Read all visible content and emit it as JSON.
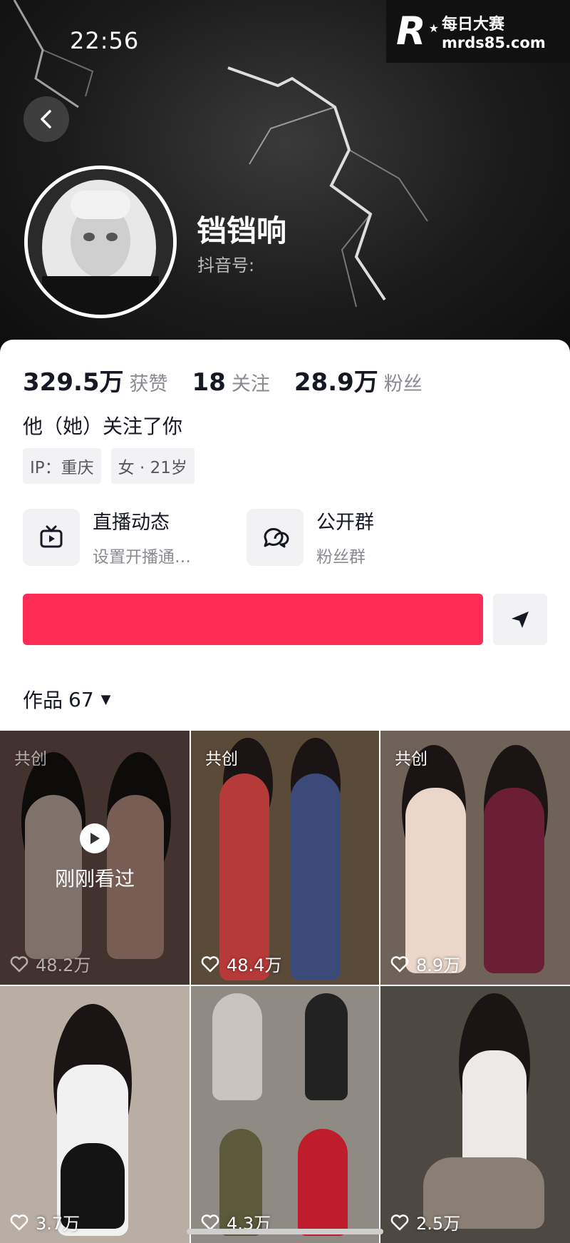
{
  "status_bar": {
    "time": "22:56"
  },
  "watermark": {
    "logo_letter": "R",
    "name": "每日大赛",
    "url": "mrds85.com"
  },
  "profile": {
    "nickname": "铛铛响",
    "douyin_id_label": "抖音号:",
    "stats": [
      {
        "value": "329.5万",
        "label": "获赞"
      },
      {
        "value": "18",
        "label": "关注"
      },
      {
        "value": "28.9万",
        "label": "粉丝"
      }
    ],
    "follow_relation": "他（她）关注了你",
    "tags": [
      "IP：重庆",
      "女 · 21岁"
    ]
  },
  "entries": [
    {
      "title": "直播动态",
      "subtitle": "设置开播通…",
      "icon": "tv-icon"
    },
    {
      "title": "公开群",
      "subtitle": "粉丝群",
      "icon": "chat-bubbles-icon"
    }
  ],
  "actions": {
    "follow_label": "",
    "send_icon": "send-icon"
  },
  "works": {
    "label": "作品",
    "count": "67"
  },
  "videos": [
    {
      "likes": "48.2万",
      "cocreate": "共创",
      "watched": "刚刚看过"
    },
    {
      "likes": "48.4万",
      "cocreate": "共创"
    },
    {
      "likes": "8.9万",
      "cocreate": "共创"
    },
    {
      "likes": "3.7万"
    },
    {
      "likes": "4.3万"
    },
    {
      "likes": "2.5万"
    }
  ],
  "colors": {
    "accent": "#fe2c55",
    "header_bg": "#1b1b1b"
  }
}
